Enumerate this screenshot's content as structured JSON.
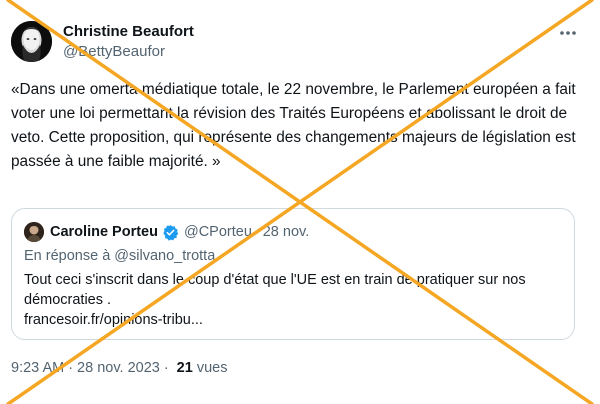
{
  "tweet": {
    "author": {
      "name": "Christine Beaufort",
      "handle": "@BettyBeaufor"
    },
    "text": "«Dans une omerta médiatique totale, le 22 novembre, le Parlement européen a fait voter une loi permettant la révision des Traités Européens et abolissant le droit de veto. Cette proposition, qui représente des changements majeurs de législation est passée à une faible majorité. »",
    "more_icon": "more-horizontal-icon",
    "timestamp": {
      "time": "9:23 AM",
      "separator": "·",
      "date": "28 nov. 2023",
      "views_separator": "·",
      "views_count": "21",
      "views_label": "vues"
    }
  },
  "quote": {
    "author": {
      "name": "Caroline Porteu",
      "handle": "@CPorteu",
      "separator": "·",
      "date": "28 nov.",
      "verified_icon": "verified-badge-icon"
    },
    "reply_prefix": "En réponse à",
    "reply_to": "@silvano_trotta",
    "text": "Tout ceci s'inscrit dans le coup d'état que l'UE est en train de pratiquer sur nos démocraties .",
    "link": "francesoir.fr/opinions-tribu..."
  },
  "overlay": {
    "type": "cross-mark",
    "color": "#f5a623"
  }
}
